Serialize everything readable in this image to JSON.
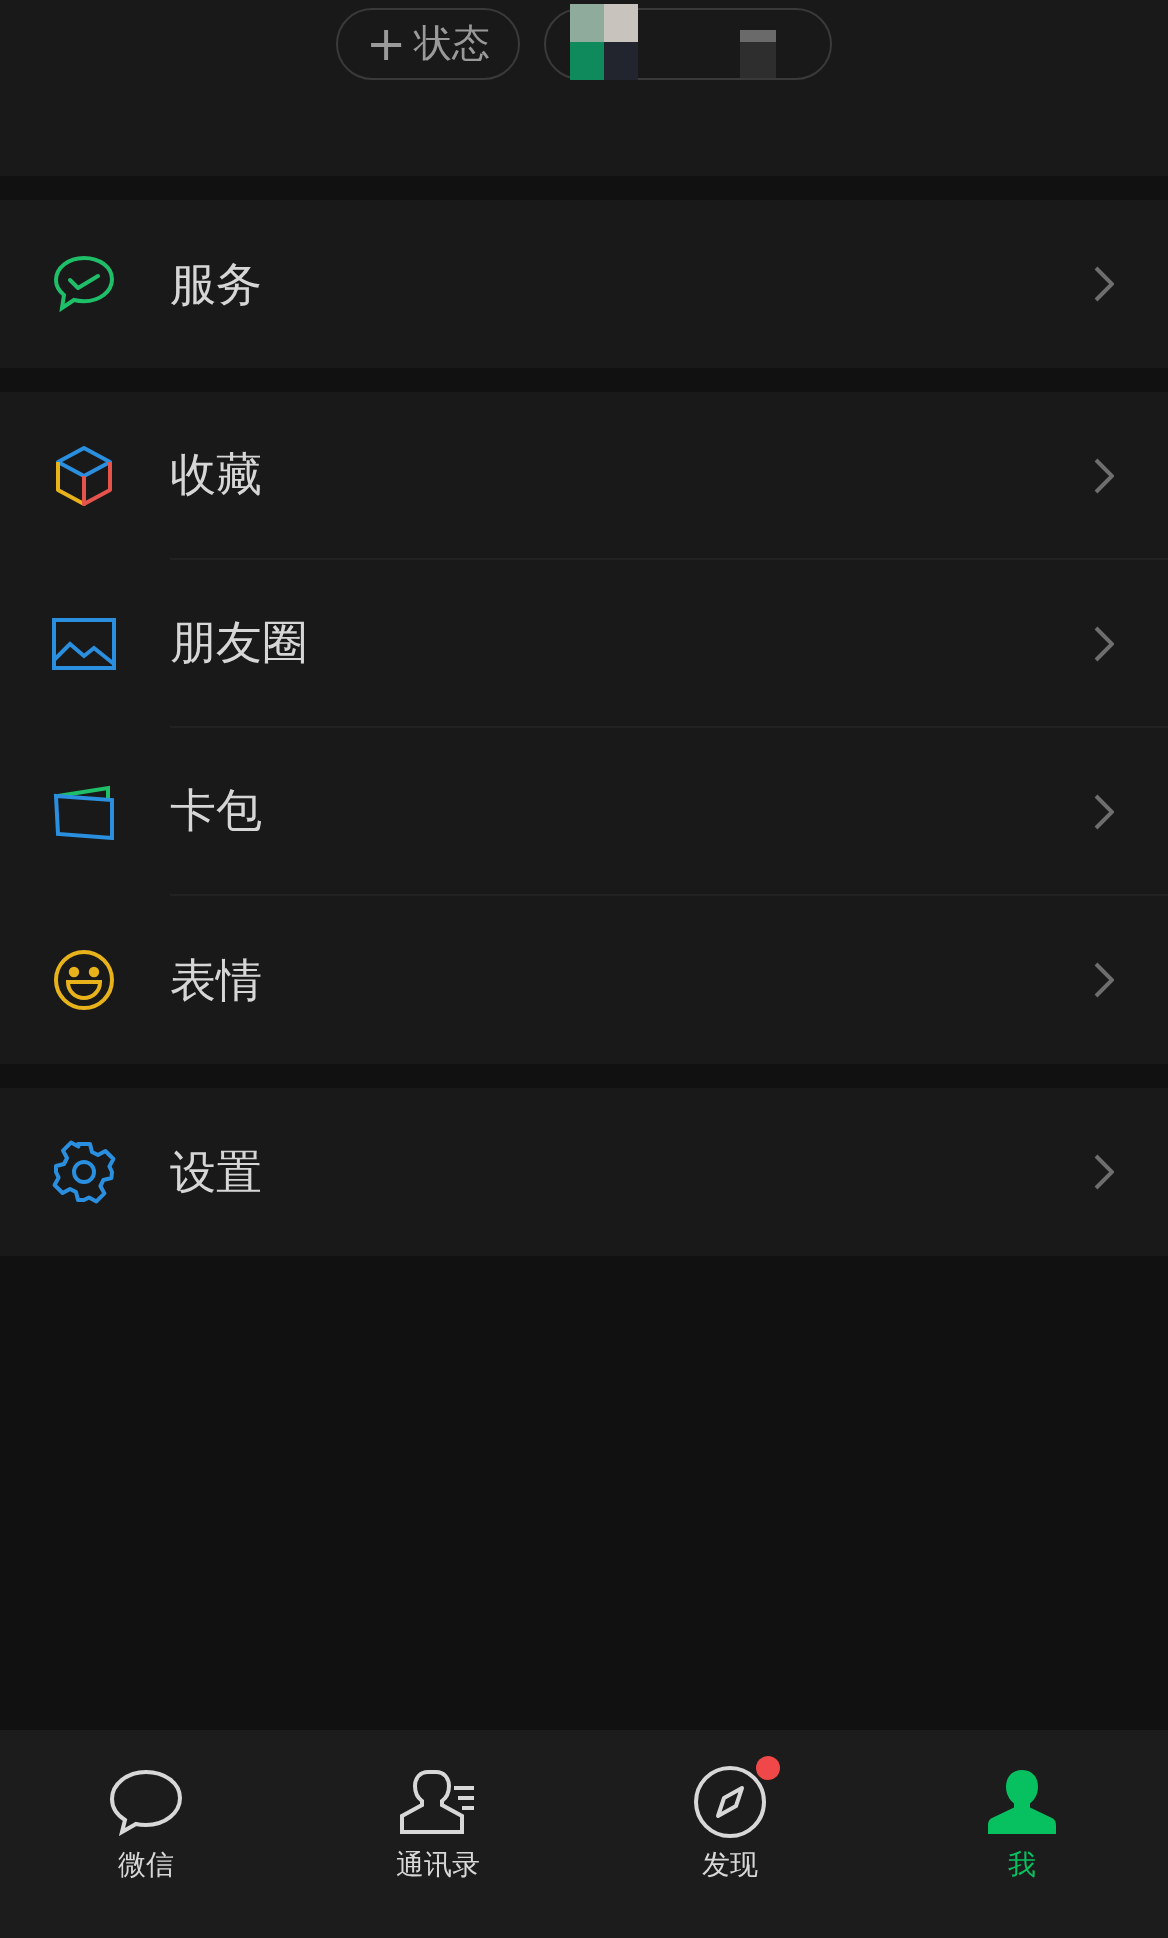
{
  "header": {
    "status_button": {
      "icon": "+",
      "label": "状态"
    }
  },
  "groups": [
    [
      {
        "label": "服务"
      }
    ],
    [
      {
        "label": "收藏"
      },
      {
        "label": "朋友圈"
      },
      {
        "label": "卡包"
      },
      {
        "label": "表情"
      }
    ],
    [
      {
        "label": "设置"
      }
    ]
  ],
  "tab_bar": [
    {
      "label": "微信",
      "selected": false,
      "dot": false
    },
    {
      "label": "通讯录",
      "selected": false,
      "dot": false
    },
    {
      "label": "发现",
      "selected": false,
      "dot": true
    },
    {
      "label": "我",
      "selected": true,
      "dot": false
    }
  ]
}
